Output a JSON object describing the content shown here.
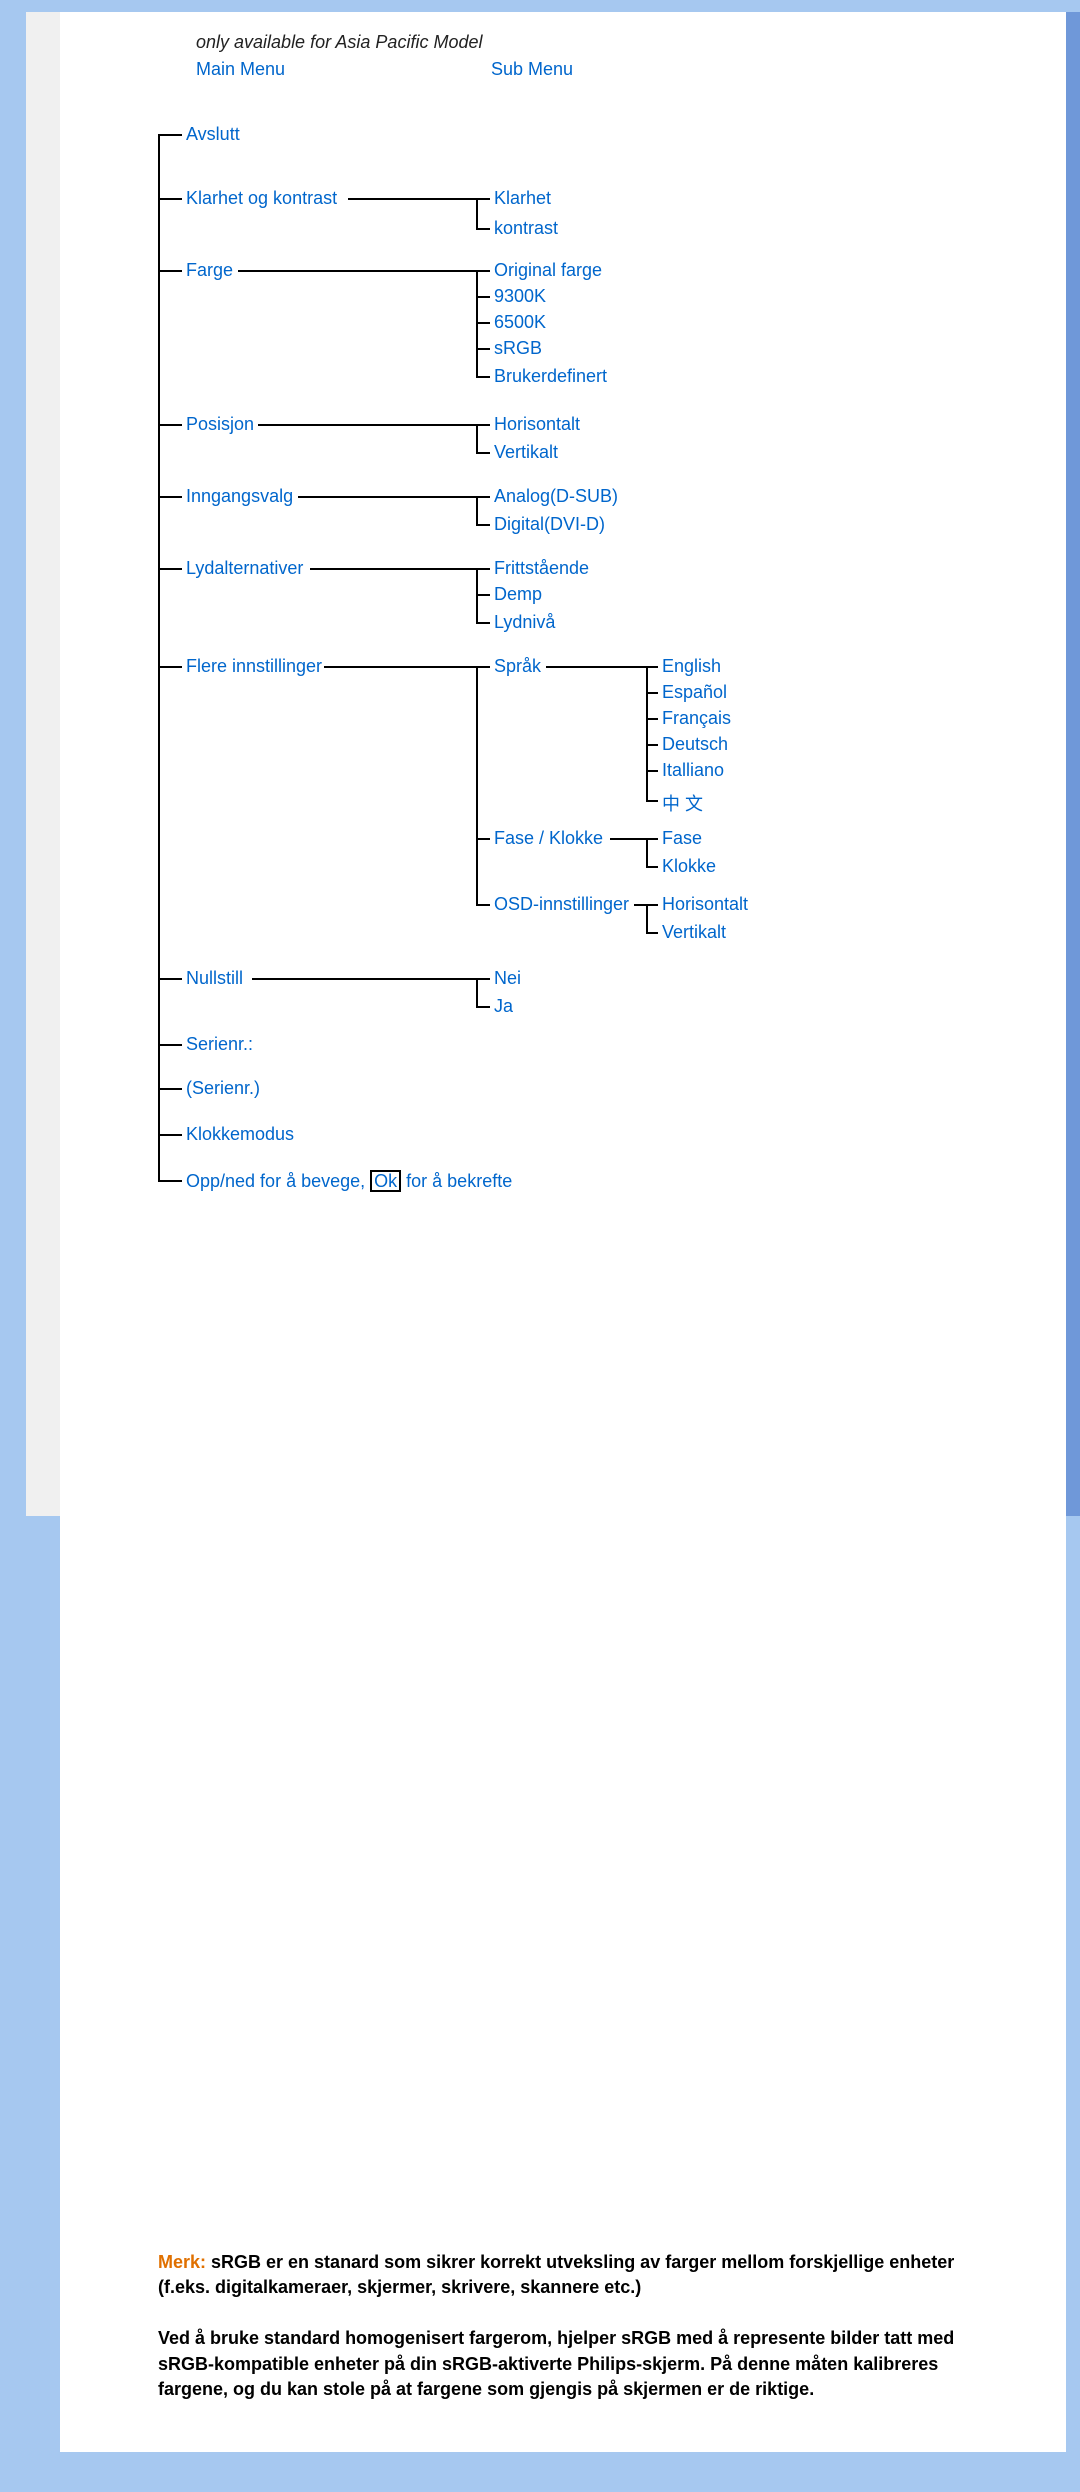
{
  "note": "only available for Asia Pacific Model",
  "headers": {
    "main": "Main Menu",
    "sub": "Sub Menu"
  },
  "menu": {
    "avslutt": "Avslutt",
    "klarhet_og_kontrast": "Klarhet og kontrast",
    "klarhet": "Klarhet",
    "kontrast": "kontrast",
    "farge": "Farge",
    "original_farge": "Original farge",
    "k9300": "9300K",
    "k6500": "6500K",
    "srgb": "sRGB",
    "brukerdefinert": "Brukerdefinert",
    "posisjon": "Posisjon",
    "horisontalt": "Horisontalt",
    "vertikalt": "Vertikalt",
    "inngangsvalg": "Inngangsvalg",
    "analog": "Analog(D-SUB)",
    "digital": "Digital(DVI-D)",
    "lydalternativer": "Lydalternativer",
    "frittstaende": "Frittstående",
    "demp": "Demp",
    "lydniva": "Lydnivå",
    "flere_innstillinger": "Flere innstillinger",
    "sprak": "Språk",
    "english": "English",
    "espanol": "Español",
    "francais": "Français",
    "deutsch": "Deutsch",
    "italliano": "Italliano",
    "chinese": "中 文",
    "fase_klokke": "Fase / Klokke",
    "fase": "Fase",
    "klokke": "Klokke",
    "osd_innstillinger": "OSD-innstillinger",
    "nullstill": "Nullstill",
    "nei": "Nei",
    "ja": "Ja",
    "serienr": "Serienr.:",
    "serienr_paren": "(Serienr.)",
    "klokkemodus": "Klokkemodus",
    "hint_pre": "Opp/ned for å bevege, ",
    "hint_ok": "Ok",
    "hint_post": " for å bekrefte"
  },
  "merk": {
    "label": "Merk:",
    "body": " sRGB er en stanard som sikrer korrekt utveksling av farger mellom forskjellige enheter (f.eks. digitalkameraer, skjermer, skrivere, skannere etc.)"
  },
  "para2": "Ved å bruke standard homogenisert fargerom, hjelper sRGB med å represente bilder tatt med sRGB-kompatible enheter på din sRGB-aktiverte Philips-skjerm. På denne måten kalibreres fargene, og du kan stole på at fargene som gjengis på skjermen er de riktige."
}
